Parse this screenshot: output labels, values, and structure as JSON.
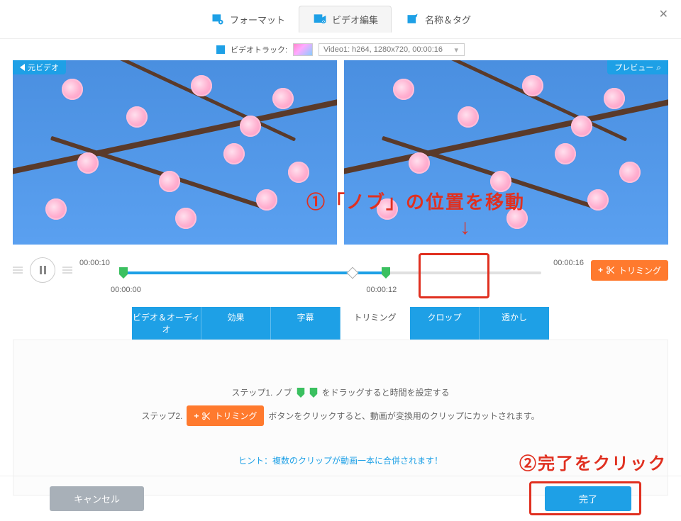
{
  "top_tabs": {
    "format": "フォーマット",
    "edit": "ビデオ編集",
    "tag": "名称＆タグ"
  },
  "track": {
    "label": "ビデオトラック:",
    "selected": "Video1: h264, 1280x720, 00:00:16"
  },
  "badges": {
    "source": "元ビデオ",
    "preview": "プレビュー"
  },
  "timeline": {
    "start": "00:00:10",
    "end": "00:00:16",
    "knob_left": "00:00:00",
    "knob_right": "00:00:12",
    "trim_button": "トリミング"
  },
  "subtabs": {
    "va": "ビデオ＆オーディオ",
    "effect": "効果",
    "subtitle": "字幕",
    "trim": "トリミング",
    "crop": "クロップ",
    "watermark": "透かし"
  },
  "panel": {
    "step1_prefix": "ステップ1. ノブ",
    "step1_suffix": "をドラッグすると時間を設定する",
    "step2_prefix": "ステップ2.",
    "step2_button": "トリミング",
    "step2_suffix": "ボタンをクリックすると、動画が変換用のクリップにカットされます。",
    "hint": "ヒント：複数のクリップが動画一本に合併されます！"
  },
  "footer": {
    "cancel": "キャンセル",
    "ok": "完了"
  },
  "annotations": {
    "a1": "①「ノブ」の位置を移動",
    "arrow": "↓",
    "a2": "②完了をクリック"
  }
}
